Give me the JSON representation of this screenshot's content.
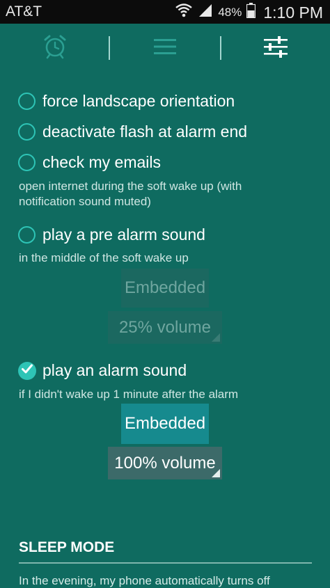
{
  "status_bar": {
    "carrier": "AT&T",
    "battery_percent": "48%",
    "time": "1:10 PM",
    "icons": [
      "wifi-icon",
      "signal-icon",
      "battery-icon"
    ]
  },
  "tabs": [
    {
      "icon": "alarm-clock-icon",
      "selected": false
    },
    {
      "icon": "menu-icon",
      "selected": false
    },
    {
      "icon": "settings-sliders-icon",
      "selected": true
    }
  ],
  "options": {
    "force_landscape": {
      "label": "force landscape orientation",
      "checked": false
    },
    "deactivate_flash": {
      "label": "deactivate flash at alarm end",
      "checked": false
    },
    "check_emails": {
      "label": "check my emails",
      "checked": false,
      "description_line1": "open internet during the soft wake up (with",
      "description_line2": "notification sound muted)"
    },
    "pre_alarm_sound": {
      "label": "play a pre alarm sound",
      "checked": false,
      "description": "in the middle of the soft wake up",
      "sound_button": "Embedded",
      "volume_button": "25% volume"
    },
    "alarm_sound": {
      "label": "play an alarm sound",
      "checked": true,
      "description": "if I didn't wake up 1 minute after the alarm",
      "sound_button": "Embedded",
      "volume_button": "100% volume"
    }
  },
  "sleep_mode": {
    "title": "SLEEP MODE",
    "text": "In the evening, my phone automatically turns off"
  },
  "colors": {
    "background": "#0f6b60",
    "accent": "#2ec4b6",
    "active_button": "#168a8e",
    "status_bar": "#0c0c0c"
  }
}
